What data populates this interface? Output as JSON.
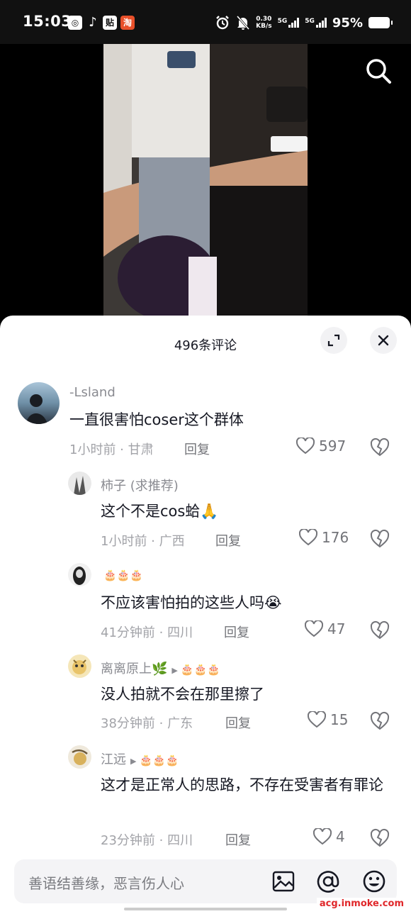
{
  "status_bar": {
    "time": "15:03",
    "app_icons": [
      "notification-icon",
      "tiktok-icon",
      "tieba-icon",
      "taobao-icon"
    ],
    "speed_value": "0.30",
    "speed_unit": "KB/s",
    "net1": "5G",
    "net2": "5G",
    "battery": "95%"
  },
  "video": {
    "search_icon": "search-icon"
  },
  "panel": {
    "title": "496条评论",
    "expand_icon": "expand-icon",
    "close_icon": "close-icon"
  },
  "comments": [
    {
      "user": "-Lsland",
      "text": "一直很害怕coser这个群体",
      "time_loc": "1小时前 · 甘肃",
      "reply": "回复",
      "likes": "597"
    },
    {
      "user": "柿子 (求推荐)",
      "text": "这个不是cos蛤🙏",
      "time_loc": "1小时前 · 广西",
      "reply": "回复",
      "likes": "176"
    },
    {
      "user": "",
      "badges": "🎂🎂🎂",
      "text": "不应该害怕拍的这些人吗😭",
      "time_loc": "41分钟前 · 四川",
      "reply": "回复",
      "likes": "47"
    },
    {
      "user": "离离原上🌿",
      "badges": "🎂🎂🎂",
      "text": "没人拍就不会在那里擦了",
      "time_loc": "38分钟前 · 广东",
      "reply": "回复",
      "likes": "15"
    },
    {
      "user": "江远",
      "badges": "🎂🎂🎂",
      "text": "这才是正常人的思路，不存在受害者有罪论",
      "time_loc": "23分钟前 · 四川",
      "reply": "回复",
      "likes": "4"
    }
  ],
  "input": {
    "placeholder": "善语结善缘，恶言伤人心",
    "icons": [
      "image-icon",
      "at-icon",
      "emoji-icon"
    ]
  },
  "watermark": "acg.inmoke.com",
  "colors": {
    "text_primary": "#161823",
    "text_secondary": "#8a8b91",
    "watermark": "#e0282b"
  }
}
